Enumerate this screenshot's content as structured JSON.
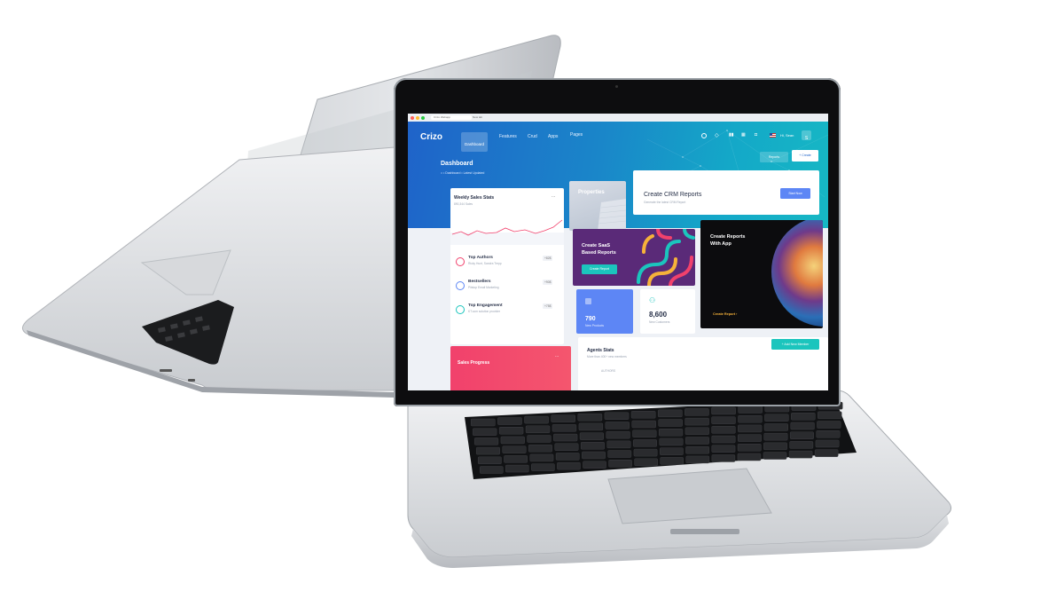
{
  "browser": {
    "tab_title": "Crizo Webapp",
    "tab_new": "New tab"
  },
  "app": {
    "brand": "Crizo",
    "nav": [
      "Dashboard",
      "Features",
      "Crud",
      "Apps",
      "Pages"
    ],
    "user_greeting": "Hi, Sean",
    "user_initial": "S",
    "reports_button": "Reports",
    "create_button": "+ Create"
  },
  "page": {
    "title": "Dashboard",
    "breadcrumb": [
      "Dashboard",
      "Latest Updated"
    ]
  },
  "weekly_sales": {
    "title": "Weekly Sales Stats",
    "subtitle": "890,344 Sales",
    "menu": "...",
    "items": [
      {
        "title": "Top Authors",
        "subtitle": "Ricky Hunt, Sandra Trepp",
        "badge": "+82$"
      },
      {
        "title": "Bestsellers",
        "subtitle": "Pitstop Email Marketing",
        "badge": "+90$"
      },
      {
        "title": "Top Engagement",
        "subtitle": "KT.com solution provider",
        "badge": "+75$"
      }
    ]
  },
  "properties": {
    "title": "Properties"
  },
  "crm": {
    "title": "Create CRM Reports",
    "subtitle": "Generate the latest CRM Report",
    "button": "Start Now"
  },
  "saas": {
    "title_line1": "Create SaaS",
    "title_line2": "Based Reports",
    "button": "Create Report"
  },
  "app_report": {
    "title_line1": "Create Reports",
    "title_line2": "With App",
    "link": "Create Report"
  },
  "stats": {
    "products_value": "790",
    "products_label": "New Products",
    "customers_value": "8,600",
    "customers_label": "New Customers"
  },
  "sales_progress": {
    "title": "Sales Progress",
    "menu": "..."
  },
  "agents": {
    "title": "Agents Stats",
    "subtitle": "More than 400+ new members",
    "button": "Add New Member",
    "row_hint": "AUTHORS"
  },
  "colors": {
    "hero_start": "#1f63c9",
    "hero_end": "#16b8c4",
    "teal": "#1bc5bd",
    "saas_bg": "#5a2a78",
    "sales_red": "#f1416c",
    "product_blue": "#5d86f5"
  }
}
